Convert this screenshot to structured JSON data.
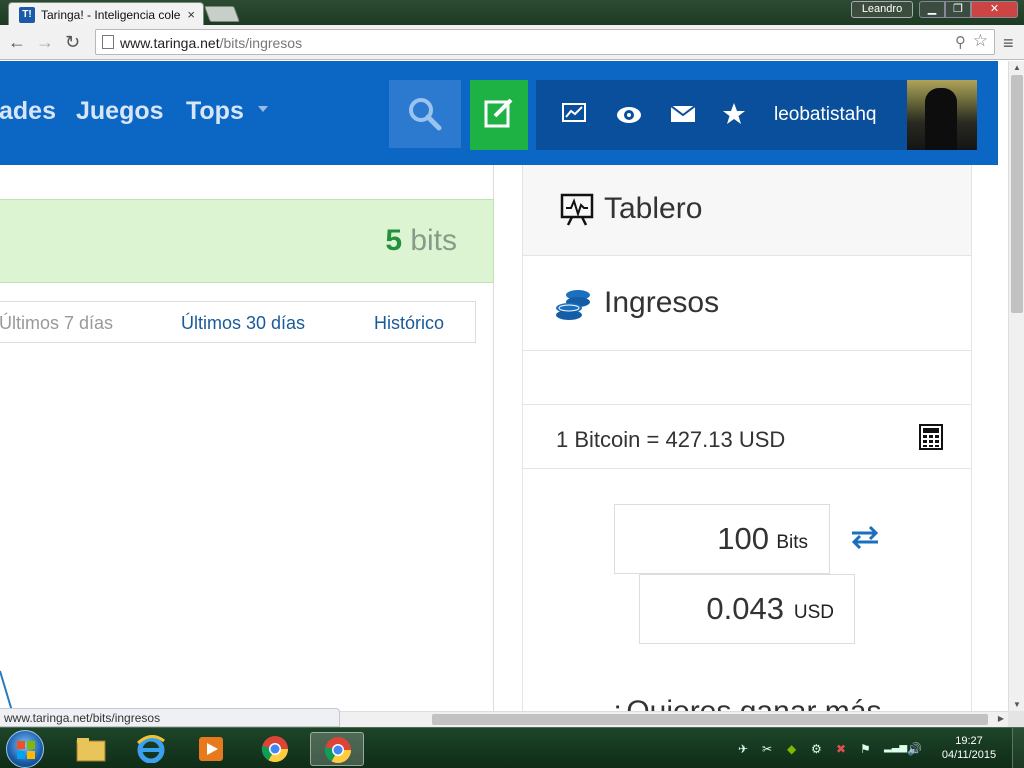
{
  "browser": {
    "tab_title": "Taringa! - Inteligencia cole",
    "tab_favicon": "T!",
    "tab_close": "×",
    "url_host": "www.taringa.net",
    "url_path": "/bits/ingresos",
    "window_user": "Leandro",
    "status_url": "www.taringa.net/bits/ingresos"
  },
  "header": {
    "nav_items": [
      "ades",
      "Juegos",
      "Tops"
    ],
    "username": "leobatistahq",
    "icons": [
      "search-icon",
      "compose-icon",
      "stats-icon",
      "eye-icon",
      "mail-icon",
      "star-icon"
    ],
    "colors": {
      "header_bg": "#0c66c4",
      "compose_bg": "#1eb144",
      "user_panel_bg": "#0a4f9c"
    }
  },
  "main": {
    "bits_amount": "5",
    "bits_unit": "bits",
    "periods": [
      "Últimos 7 días",
      "Últimos 30 días",
      "Histórico"
    ]
  },
  "sidebar": {
    "tablero_label": "Tablero",
    "ingresos_label": "Ingresos",
    "rate": "1 Bitcoin = 427.13 USD",
    "converter": {
      "bits_value": "100",
      "bits_unit": "Bits",
      "usd_value": "0.043",
      "usd_unit": "USD"
    },
    "cut_heading": "¿Quieres ganar más"
  },
  "taskbar": {
    "clock_time": "19:27",
    "clock_date": "04/11/2015"
  }
}
